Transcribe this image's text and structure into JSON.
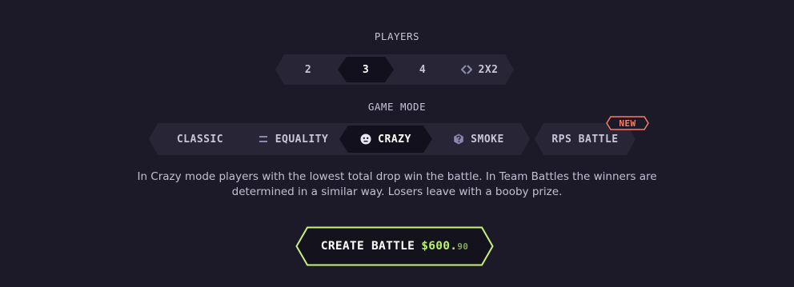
{
  "players": {
    "title": "PLAYERS",
    "options": [
      "2",
      "3",
      "4",
      "2X2"
    ],
    "selected": "3"
  },
  "game_mode": {
    "title": "GAME MODE",
    "options": [
      "CLASSIC",
      "EQUALITY",
      "CRAZY",
      "SMOKE",
      "RPS BATTLE"
    ],
    "selected": "CRAZY",
    "new_badge": "NEW"
  },
  "description": {
    "line1": "In Crazy mode players with the lowest total drop win the battle. In Team Battles the winners are",
    "line2": "determined in a similar way. Losers leave with a booby prize."
  },
  "create_button": {
    "label": "CREATE BATTLE",
    "price_main": "$600.",
    "price_cents": "90"
  },
  "colors": {
    "background": "#1c1a29",
    "segment": "#272536",
    "segment_active": "#12101c",
    "accent_green": "#b8f26b",
    "badge_red": "#ff7b62"
  },
  "icons": {
    "team": "arrows-split-icon",
    "equality": "equality-icon",
    "crazy": "crazy-face-icon",
    "smoke": "smoke-question-icon"
  }
}
